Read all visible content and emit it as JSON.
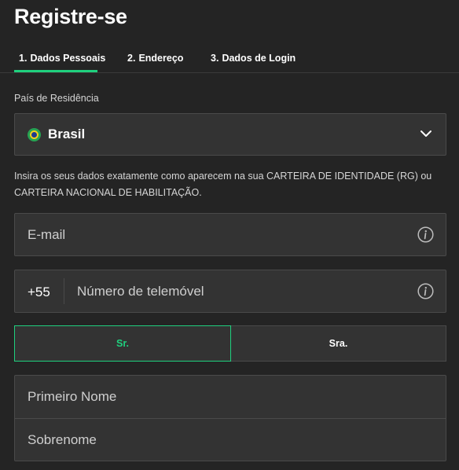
{
  "header": {
    "title": "Registre-se"
  },
  "tabs": [
    {
      "number": "1.",
      "label": "Dados Pessoais",
      "active": true
    },
    {
      "number": "2.",
      "label": "Endereço",
      "active": false
    },
    {
      "number": "3.",
      "label": "Dados de Login",
      "active": false
    }
  ],
  "country": {
    "label": "País de Residência",
    "value": "Brasil",
    "flag_icon": "brazil-flag-icon",
    "dropdown_icon": "chevron-down-icon"
  },
  "instructions": "Insira os seus dados exatamente como aparecem na sua CARTEIRA DE IDENTIDADE (RG) ou CARTEIRA NACIONAL DE HABILITAÇÃO.",
  "email": {
    "placeholder": "E-mail",
    "info_icon": "info-icon"
  },
  "phone": {
    "prefix": "+55",
    "placeholder": "Número de telemóvel",
    "info_icon": "info-icon"
  },
  "gender": {
    "options": [
      {
        "label": "Sr.",
        "selected": true
      },
      {
        "label": "Sra.",
        "selected": false
      }
    ]
  },
  "name": {
    "first_placeholder": "Primeiro Nome",
    "last_placeholder": "Sobrenome"
  },
  "colors": {
    "accent": "#1fd07e",
    "background": "#242424",
    "field_bg": "#333333",
    "border": "#4a4a4a"
  }
}
